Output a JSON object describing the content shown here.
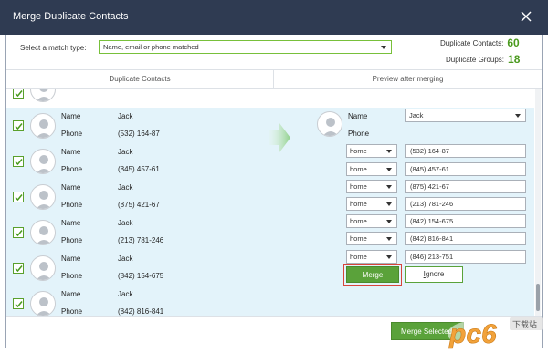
{
  "window": {
    "title": "Merge Duplicate Contacts"
  },
  "match": {
    "label": "Select a match type:",
    "selected": "Name, email or phone matched"
  },
  "stats": {
    "contacts_label": "Duplicate Contacts:",
    "contacts_value": "60",
    "groups_label": "Duplicate Groups:",
    "groups_value": "18",
    "value_color": "#4a9a1e"
  },
  "columns": {
    "left": "Duplicate Contacts",
    "right": "Preview after merging"
  },
  "field_labels": {
    "name": "Name",
    "phone": "Phone"
  },
  "contacts": [
    {
      "name": "Jack",
      "phone": "(532) 164-87"
    },
    {
      "name": "Jack",
      "phone": "(845) 457-61"
    },
    {
      "name": "Jack",
      "phone": "(875) 421-67"
    },
    {
      "name": "Jack",
      "phone": "(213) 781-246"
    },
    {
      "name": "Jack",
      "phone": "(842) 154-675"
    },
    {
      "name": "Jack",
      "phone": "(842) 816-841"
    }
  ],
  "preview": {
    "name_value": "Jack",
    "phones": [
      {
        "type": "home",
        "value": "(532) 164-87"
      },
      {
        "type": "home",
        "value": "(845) 457-61"
      },
      {
        "type": "home",
        "value": "(875) 421-67"
      },
      {
        "type": "home",
        "value": "(213) 781-246"
      },
      {
        "type": "home",
        "value": "(842) 154-675"
      },
      {
        "type": "home",
        "value": "(842) 816-841"
      },
      {
        "type": "home",
        "value": "(846) 213-751"
      }
    ]
  },
  "buttons": {
    "merge": "Merge",
    "ignore_first": "I",
    "ignore_rest": "gnore",
    "merge_selected": "Merge Selected"
  },
  "watermark": {
    "text": "pc6",
    "suffix": "下载站"
  },
  "colors": {
    "titlebar": "#2f3b52",
    "accent_green": "#5aa23a",
    "selected_row": "#e3f3fa",
    "merge_outline": "#d9443a"
  },
  "icons": {
    "close": "close-icon",
    "checkbox": "check-icon",
    "avatar": "user-avatar-icon",
    "arrow": "right-arrow-icon"
  }
}
